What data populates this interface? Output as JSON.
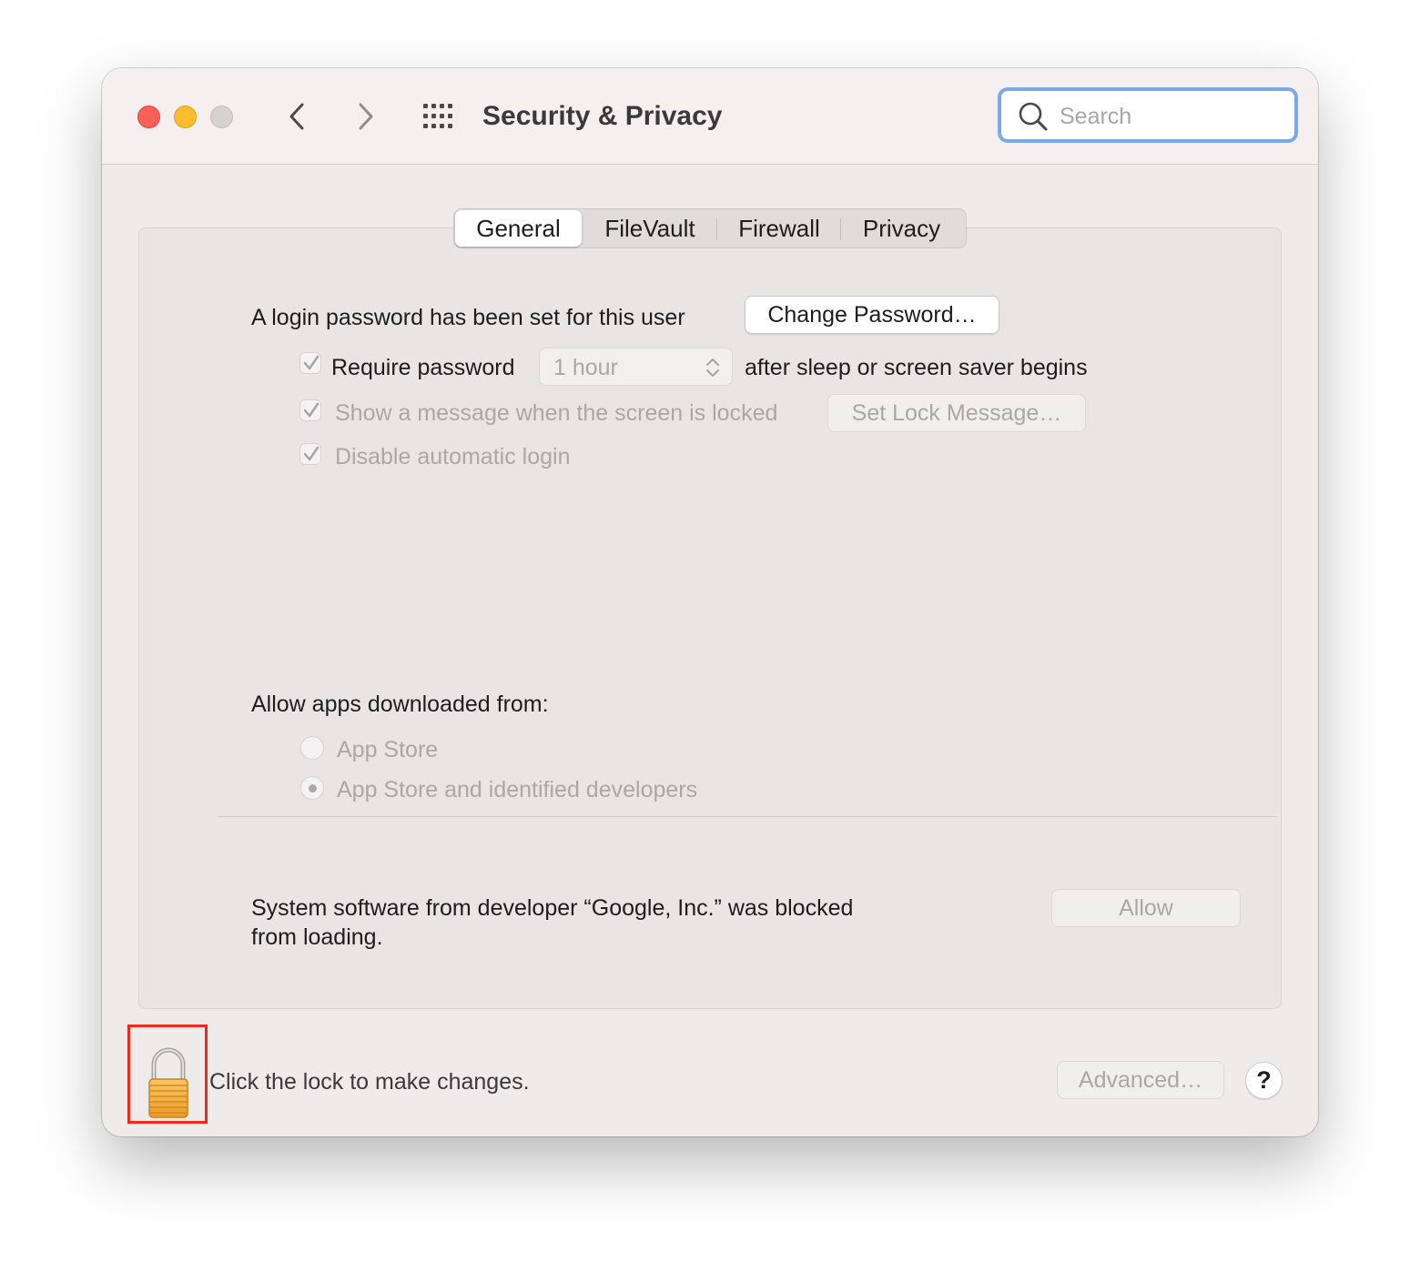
{
  "window": {
    "title": "Security & Privacy",
    "search_placeholder": "Search"
  },
  "tabs": [
    {
      "label": "General",
      "active": true
    },
    {
      "label": "FileVault",
      "active": false
    },
    {
      "label": "Firewall",
      "active": false
    },
    {
      "label": "Privacy",
      "active": false
    }
  ],
  "general": {
    "login_password_text": "A login password has been set for this user",
    "change_password_label": "Change Password…",
    "require_password_label": "Require password",
    "require_password_checked": true,
    "require_password_delay": "1 hour",
    "after_sleep_text": "after sleep or screen saver begins",
    "show_message_label": "Show a message when the screen is locked",
    "show_message_checked": true,
    "set_lock_message_label": "Set Lock Message…",
    "disable_auto_login_label": "Disable automatic login",
    "disable_auto_login_checked": true
  },
  "downloads": {
    "heading": "Allow apps downloaded from:",
    "options": [
      {
        "label": "App Store",
        "selected": false
      },
      {
        "label": "App Store and identified developers",
        "selected": true
      }
    ]
  },
  "blocked": {
    "line1": "System software from developer “Google, Inc.” was blocked",
    "line2": "from loading.",
    "allow_label": "Allow"
  },
  "footer": {
    "lock_text": "Click the lock to make changes.",
    "advanced_label": "Advanced…",
    "help_label": "?"
  },
  "colors": {
    "close": "#fe5f57",
    "minimize": "#febc2e",
    "zoom": "#d6d2d2",
    "search_focus_ring": "#7aa8ee",
    "highlight_box": "#f02a1f",
    "lock_body": "#f4b23e"
  },
  "icons": [
    "back-chevron-icon",
    "forward-chevron-icon",
    "grid-icon",
    "search-icon",
    "checkmark-icon",
    "updown-chevron-icon",
    "lock-icon"
  ]
}
